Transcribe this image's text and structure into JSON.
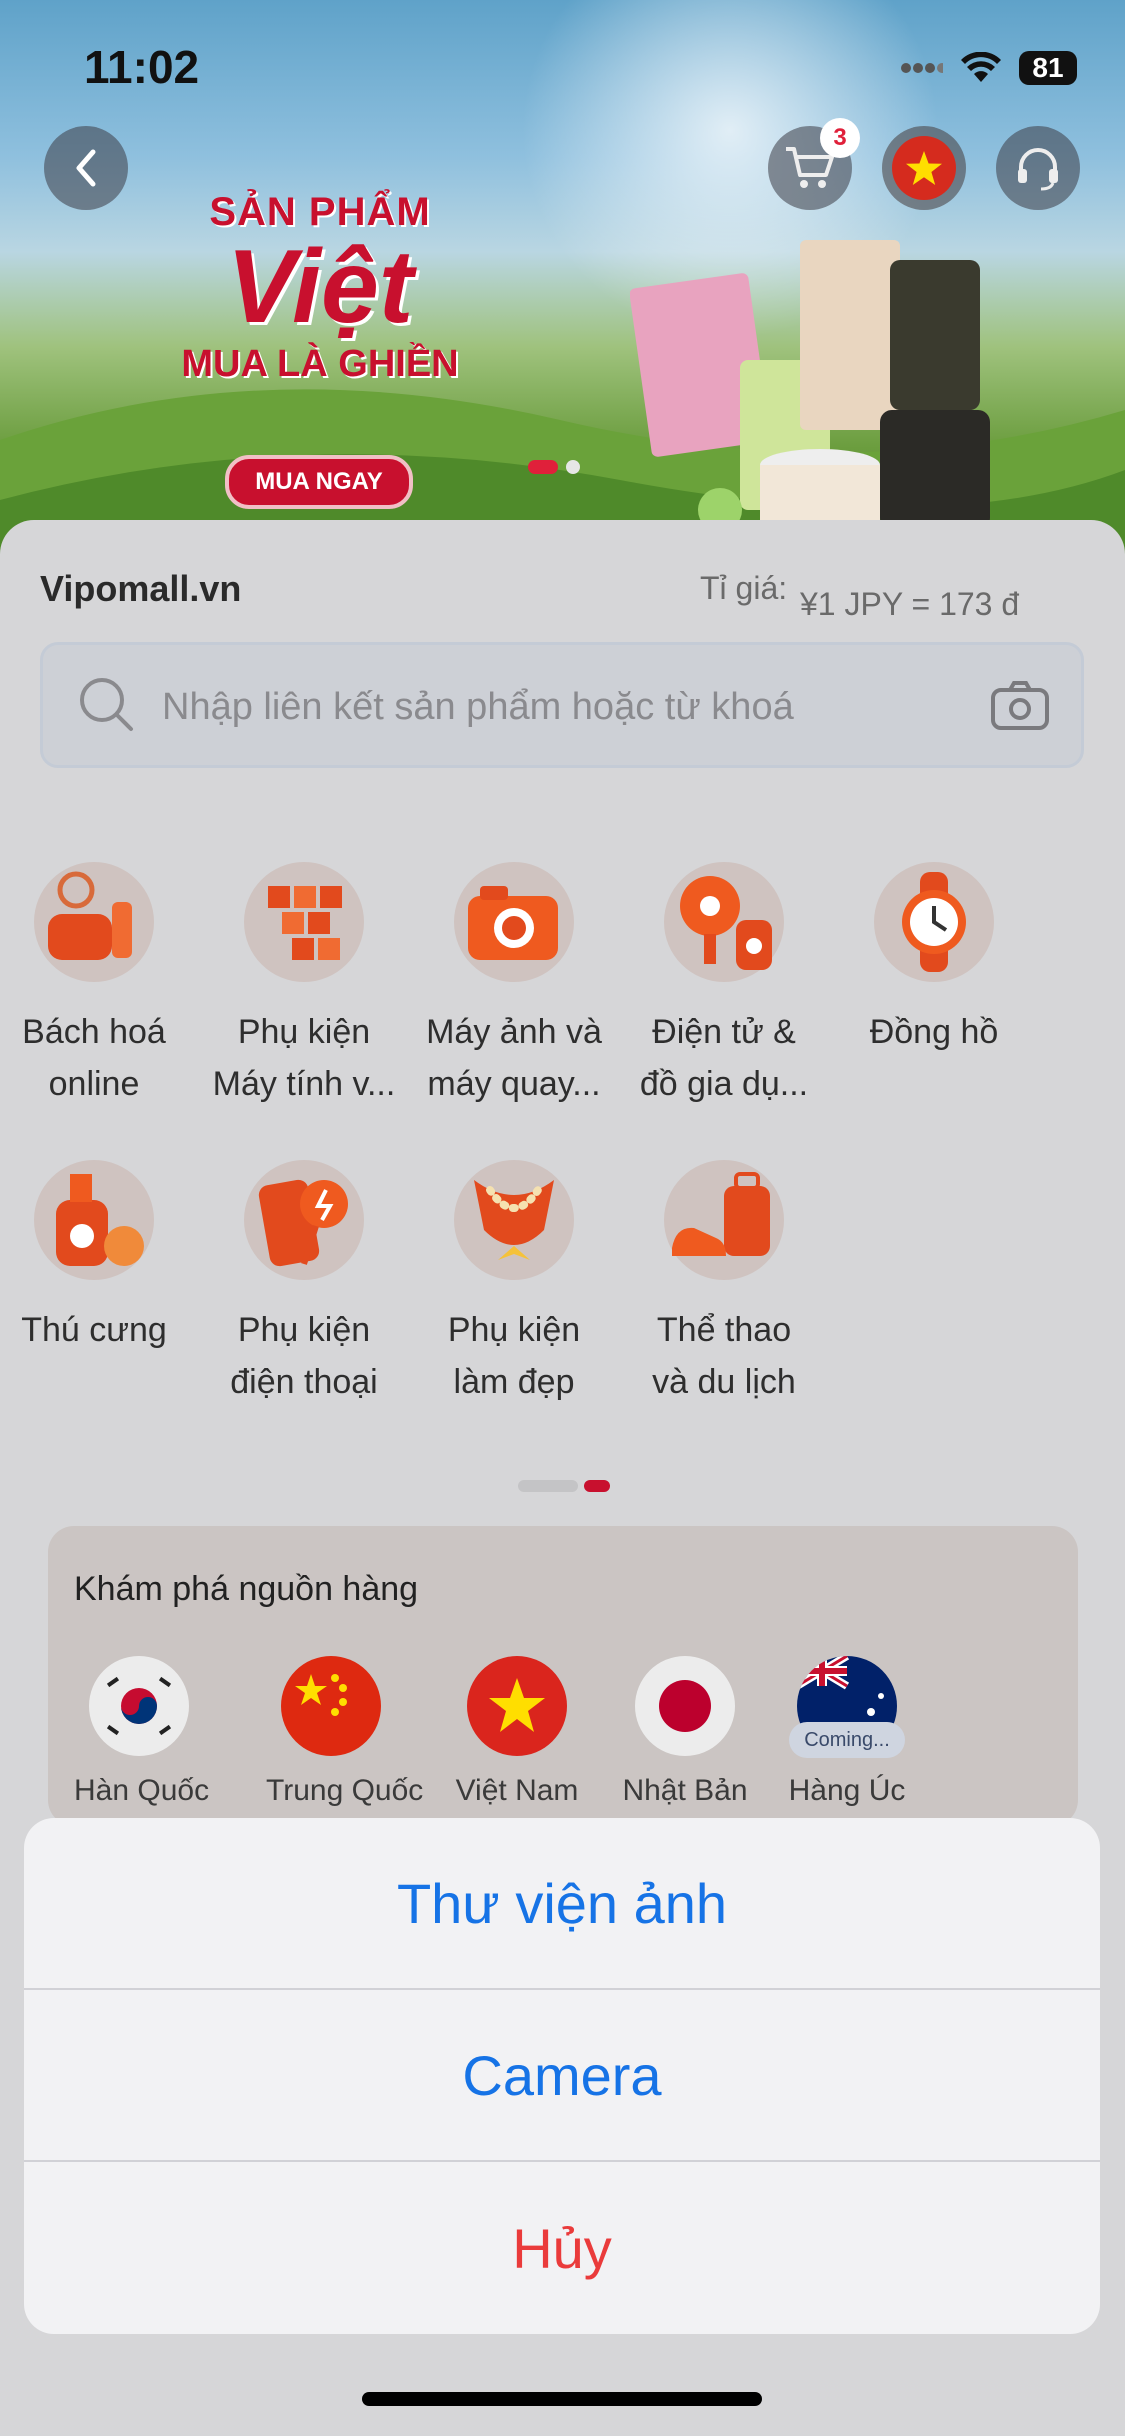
{
  "status_bar": {
    "time": "11:02",
    "battery": "81"
  },
  "header": {
    "cart_badge": "3"
  },
  "banner": {
    "line1": "SẢN PHẨM",
    "line2": "Việt",
    "line3": "MUA LÀ GHIỀN",
    "cta": "MUA NGAY"
  },
  "site": {
    "name": "Vipomall.vn",
    "rate_label": "Tỉ giá:",
    "rate_value": "¥1 JPY = 173 đ"
  },
  "search": {
    "placeholder": "Nhập liên kết sản phẩm hoặc từ khoá"
  },
  "categories": [
    {
      "label": "Bách hoá\nonline",
      "icon": "kitchen-mixer-icon"
    },
    {
      "label": "Phụ kiện\nMáy tính v...",
      "icon": "keyboard-icon"
    },
    {
      "label": "Máy ảnh và\nmáy quay...",
      "icon": "camera-icon"
    },
    {
      "label": "Điện tử &\nđồ gia dụ...",
      "icon": "fan-speaker-icon"
    },
    {
      "label": "Đồng hồ",
      "icon": "watch-icon"
    },
    {
      "label": "Thú cưng",
      "icon": "pet-shampoo-icon"
    },
    {
      "label": "Phụ kiện\nđiện thoại",
      "icon": "phone-charger-icon"
    },
    {
      "label": "Phụ kiện\nlàm đẹp",
      "icon": "necklace-icon"
    },
    {
      "label": "Thể thao\nvà du lịch",
      "icon": "shoe-luggage-icon"
    }
  ],
  "explore": {
    "title": "Khám phá nguồn hàng",
    "countries": [
      {
        "label": "Hàn Quốc",
        "icon": "korea-flag-icon"
      },
      {
        "label": "Trung Quốc",
        "icon": "china-flag-icon"
      },
      {
        "label": "Việt Nam",
        "icon": "vietnam-flag-icon"
      },
      {
        "label": "Nhật Bản",
        "icon": "japan-flag-icon"
      },
      {
        "label": "Hàng Úc",
        "icon": "australia-flag-icon",
        "badge": "Coming..."
      }
    ]
  },
  "action_sheet": {
    "photo_library": "Thư viện ảnh",
    "camera": "Camera",
    "cancel": "Hủy"
  },
  "colors": {
    "accent": "#c8102e",
    "action_blue": "#1673e6",
    "cancel_red": "#ea3b3b"
  }
}
